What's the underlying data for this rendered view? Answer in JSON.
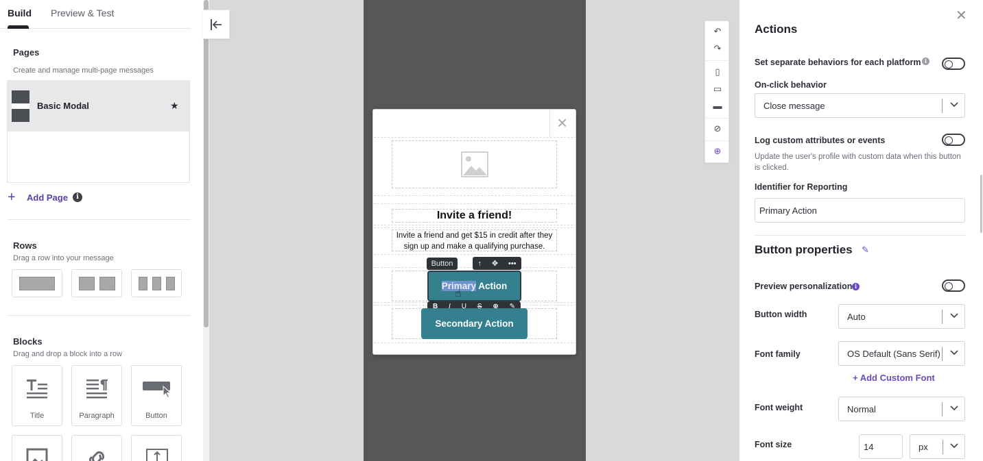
{
  "left_panel": {
    "tabs": [
      {
        "label": "Build"
      },
      {
        "label": "Preview & Test"
      }
    ],
    "pages": {
      "title": "Pages",
      "description": "Create and manage multi-page messages",
      "items": [
        {
          "name": "Basic Modal"
        }
      ],
      "add_label": "Add Page"
    },
    "rows": {
      "title": "Rows",
      "description": "Drag a row into your message"
    },
    "blocks": {
      "title": "Blocks",
      "description": "Drag and drop a block into a row",
      "items": [
        {
          "label": "Title"
        },
        {
          "label": "Paragraph"
        },
        {
          "label": "Button"
        }
      ]
    }
  },
  "canvas": {
    "modal": {
      "title": "Invite a friend!",
      "body": "Invite a friend and get $15 in credit after they sign up and make a qualifying purchase.",
      "block_tag": "Button",
      "primary_selected": "Primary",
      "primary_rest": " Action",
      "secondary_label": "Secondary Action"
    }
  },
  "right_panel": {
    "actions_title": "Actions",
    "separate_behaviors_label": "Set separate behaviors for each platform",
    "onclick_label": "On-click behavior",
    "onclick_value": "Close message",
    "log_label": "Log custom attributes or events",
    "log_description": "Update the user's profile with custom data when this button is clicked.",
    "identifier_label": "Identifier for Reporting",
    "identifier_value": "Primary Action",
    "button_properties_title": "Button properties",
    "preview_personalization_label": "Preview personalization",
    "button_width_label": "Button width",
    "button_width_value": "Auto",
    "font_family_label": "Font family",
    "font_family_value": "OS Default (Sans Serif)",
    "add_custom_font": "+ Add Custom Font",
    "font_weight_label": "Font weight",
    "font_weight_value": "Normal",
    "font_size_label": "Font size",
    "font_size_value": "14",
    "font_size_unit": "px"
  },
  "colors": {
    "accent": "#6a4bbf",
    "button_bg": "#34808f",
    "canvas_dark": "#575757"
  }
}
